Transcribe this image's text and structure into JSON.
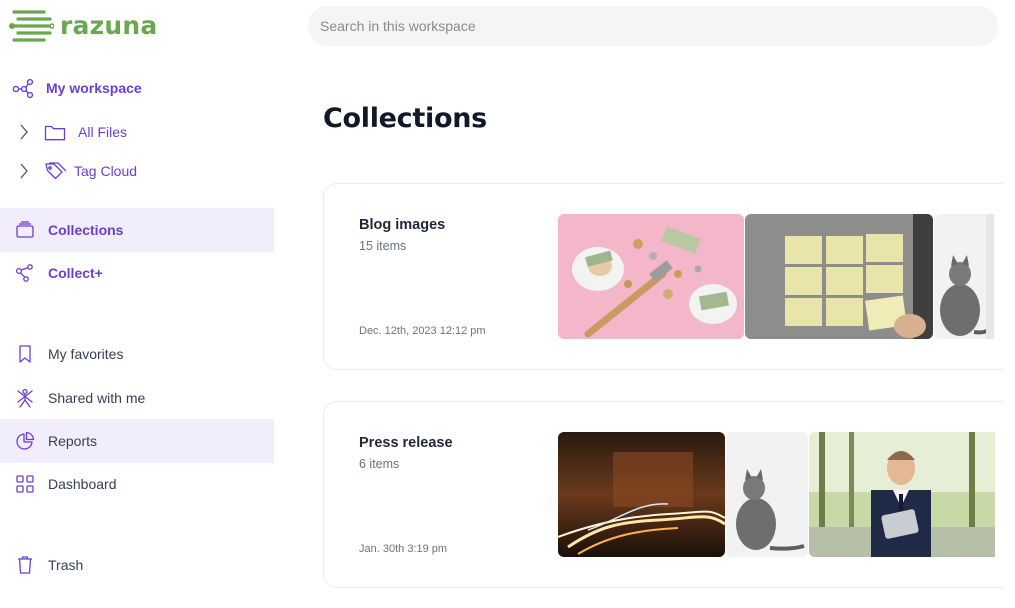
{
  "app": {
    "brand": "razuna"
  },
  "search": {
    "placeholder": "Search in this workspace"
  },
  "sidebar": {
    "workspace": "My workspace",
    "all_files": "All Files",
    "tag_cloud": "Tag Cloud",
    "collections": "Collections",
    "collect_plus": "Collect+",
    "my_favorites": "My favorites",
    "shared_with_me": "Shared with me",
    "reports": "Reports",
    "dashboard": "Dashboard",
    "trash": "Trash"
  },
  "main": {
    "title": "Collections",
    "collections": [
      {
        "name": "Blog images",
        "count": "15 items",
        "date": "Dec. 12th, 2023 12:12 pm"
      },
      {
        "name": "Press release",
        "count": "6 items",
        "date": "Jan. 30th 3:19 pm"
      }
    ]
  },
  "colors": {
    "accent": "#6b3fd1",
    "brand": "#6aa84f",
    "active_bg": "#f1edfd"
  }
}
